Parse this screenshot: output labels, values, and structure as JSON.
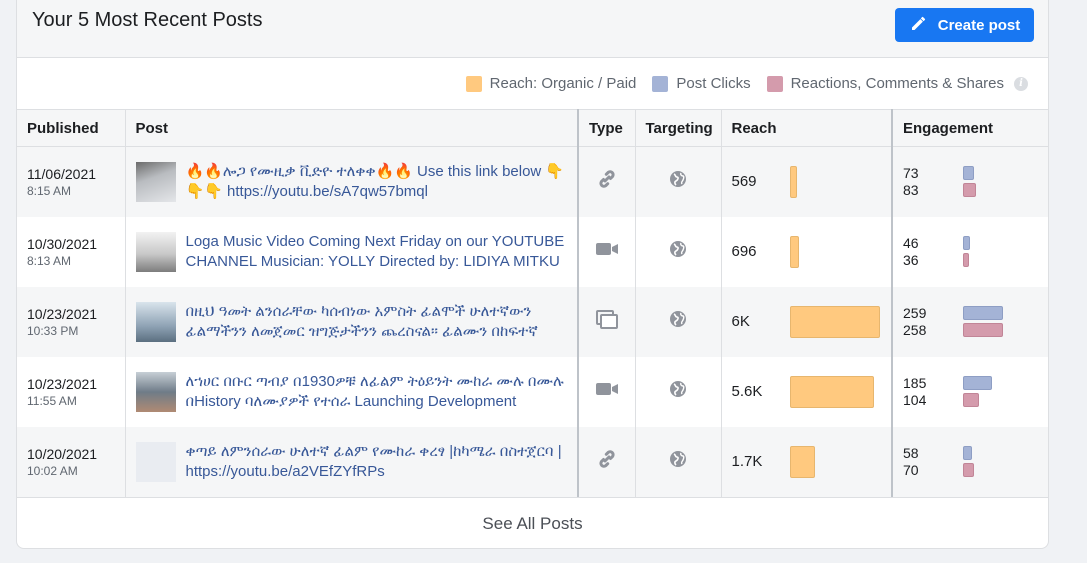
{
  "header": {
    "title": "Your 5 Most Recent Posts",
    "create_label": "Create post"
  },
  "legend": {
    "reach": "Reach: Organic / Paid",
    "clicks": "Post Clicks",
    "reactions": "Reactions, Comments & Shares",
    "info_icon": "i"
  },
  "colors": {
    "reach": "#ffc97f",
    "clicks": "#a4b3d6",
    "reactions": "#d49bac",
    "accent": "#1877f2"
  },
  "table": {
    "headers": [
      "Published",
      "Post",
      "Type",
      "Targeting",
      "Reach",
      "Engagement"
    ],
    "rows": [
      {
        "date": "11/06/2021",
        "time": "8:15 AM",
        "text": "🔥🔥ሎጋ የሙዚቃ ቪድዮ ተለቀቀ🔥🔥 Use this link below 👇 👇👇 https://youtu.be/sA7qw57bmql",
        "type_icon": "link-icon",
        "targeting_icon": "globe-icon",
        "reach": "569",
        "reach_fraction": 0.08,
        "clicks": "73",
        "reactions": "83"
      },
      {
        "date": "10/30/2021",
        "time": "8:13 AM",
        "text": "Loga Music Video Coming Next Friday on our YOUTUBE CHANNEL Musician: YOLLY Directed by: LIDIYA MITKU",
        "type_icon": "video-icon",
        "targeting_icon": "globe-icon",
        "reach": "696",
        "reach_fraction": 0.1,
        "clicks": "46",
        "reactions": "36"
      },
      {
        "date": "10/23/2021",
        "time": "10:33 PM",
        "text": "በዚህ ዓመት ልንሰራቸው ካሰብነው አምስት ፊልሞች ሁለተኛውን ፊልማችንን ለመጀመር ዝግጅታችንን ጨረስናል። ፊልሙን በከፍተኛ",
        "type_icon": "album-icon",
        "targeting_icon": "globe-icon",
        "reach": "6K",
        "reach_fraction": 1.0,
        "clicks": "259",
        "reactions": "258"
      },
      {
        "date": "10/23/2021",
        "time": "11:55 AM",
        "text": "ለኀሀር በቡር ጣብያ በ1930ዎቹ ለፊልም ትዕይንት ሙከራ ሙሉ በሙሉ በHistory ባለሙያዎች የተሰራ Launching Development",
        "type_icon": "video-icon",
        "targeting_icon": "globe-icon",
        "reach": "5.6K",
        "reach_fraction": 0.93,
        "clicks": "185",
        "reactions": "104"
      },
      {
        "date": "10/20/2021",
        "time": "10:02 AM",
        "text": "ቀጣይ ለምንሰራው ሁለተኛ ፊልም የሙከራ ቀረፃ |ከካሜራ በስተጀርባ | https://youtu.be/a2VEfZYfRPs",
        "type_icon": "link-icon",
        "targeting_icon": "globe-icon",
        "reach": "1.7K",
        "reach_fraction": 0.28,
        "clicks": "58",
        "reactions": "70"
      }
    ]
  },
  "footer": {
    "see_all": "See All Posts"
  }
}
